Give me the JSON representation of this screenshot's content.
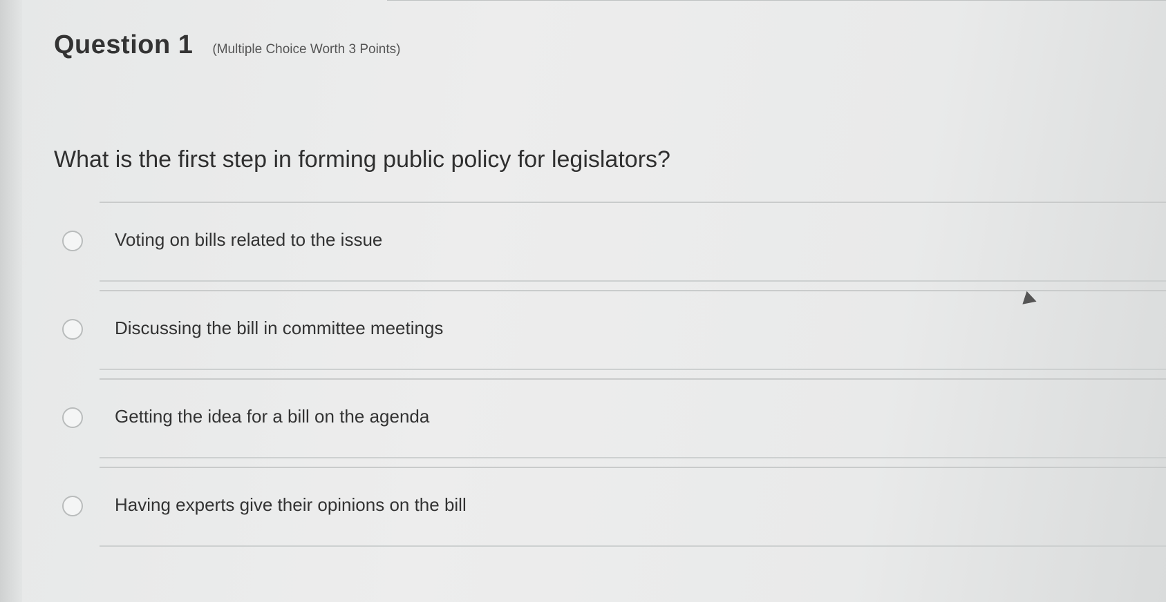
{
  "header": {
    "title": "Question 1",
    "meta": "(Multiple Choice Worth 3 Points)"
  },
  "question": {
    "text": "What is the first step in forming public policy for legislators?"
  },
  "choices": [
    {
      "label": "Voting on bills related to the issue",
      "selected": false
    },
    {
      "label": "Discussing the bill in committee meetings",
      "selected": false
    },
    {
      "label": "Getting the idea for a bill on the agenda",
      "selected": false
    },
    {
      "label": "Having experts give their opinions on the bill",
      "selected": false
    }
  ]
}
